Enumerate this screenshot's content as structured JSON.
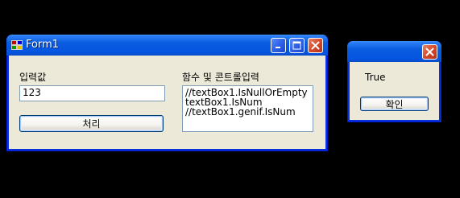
{
  "form1": {
    "title": "Form1",
    "input_label": "입력값",
    "input_value": "123",
    "process_button": "처리",
    "func_label": "함수 및 콘트롤입력",
    "code_lines": [
      "//textBox1.IsNullOrEmpty",
      "textBox1.IsNum",
      "//textBox1.genif.IsNum"
    ]
  },
  "messagebox": {
    "message": "True",
    "ok_button": "확인"
  }
}
